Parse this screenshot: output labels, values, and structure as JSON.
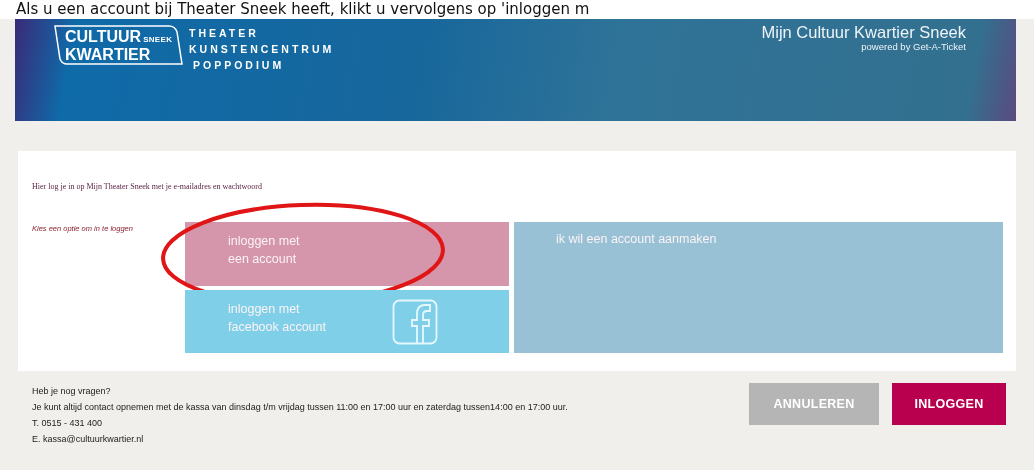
{
  "caption": "Als u een account bij Theater Sneek heeft, klikt u vervolgens op 'inloggen m",
  "header": {
    "logo": {
      "line_1": "CULTUUR",
      "tag": "SNEEK",
      "line_2": "KWARTIER"
    },
    "venues": [
      "THEATER",
      "KUNSTENCENTRUM",
      "POPPODIUM"
    ],
    "title": "Mijn Cultuur Kwartier Sneek",
    "subtitle": "powered by Get-A-Ticket"
  },
  "intro": "Hier log je in op Mijn Theater Sneek met je e-mailadres en wachtwoord",
  "prompt": "Kies een optie om in te loggen",
  "options": [
    {
      "kind": "account",
      "lines": [
        "inloggen met",
        "een account"
      ],
      "highlighted": true
    },
    {
      "kind": "facebook",
      "lines": [
        "inloggen met",
        "facebook account"
      ],
      "highlighted": false
    },
    {
      "kind": "register",
      "lines": [
        "ik wil een account aanmaken"
      ],
      "highlighted": false
    }
  ],
  "footer": [
    "Heb je nog vragen?",
    "Je kunt altijd contact opnemen met de kassa van dinsdag t/m vrijdag tussen 11:00 en 17:00 uur en zaterdag tussen14:00 en 17:00 uur.",
    "T. 0515 - 431 400",
    "E. kassa@cultuurkwartier.nl"
  ],
  "buttons": [
    {
      "kind": "secondary",
      "label": "ANNULEREN"
    },
    {
      "kind": "primary",
      "label": "INLOGGEN"
    }
  ]
}
